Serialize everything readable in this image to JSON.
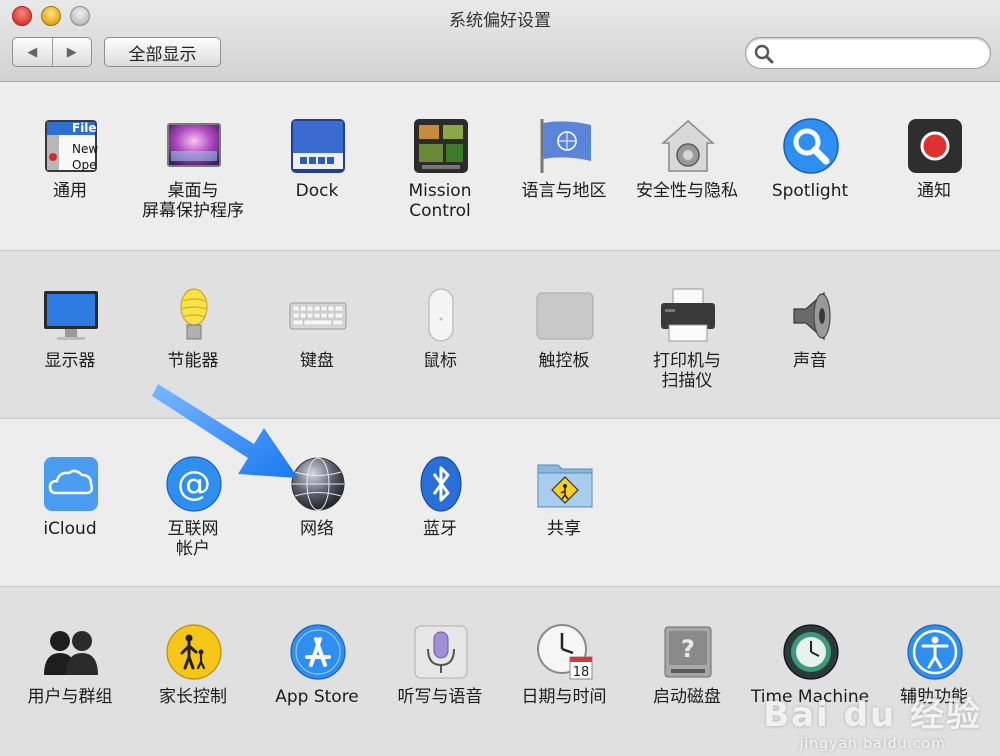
{
  "window": {
    "title": "系统偏好设置"
  },
  "toolbar": {
    "back_glyph": "◀",
    "forward_glyph": "▶",
    "show_all_label": "全部显示",
    "search_value": ""
  },
  "rows": [
    {
      "items": [
        {
          "label": "通用",
          "icon": "general-icon"
        },
        {
          "label": "桌面与\n屏幕保护程序",
          "icon": "desktop-screensaver-icon"
        },
        {
          "label": "Dock",
          "icon": "dock-icon"
        },
        {
          "label": "Mission\nControl",
          "icon": "mission-control-icon"
        },
        {
          "label": "语言与地区",
          "icon": "language-region-icon"
        },
        {
          "label": "安全性与隐私",
          "icon": "security-privacy-icon"
        },
        {
          "label": "Spotlight",
          "icon": "spotlight-icon"
        },
        {
          "label": "通知",
          "icon": "notifications-icon"
        }
      ]
    },
    {
      "items": [
        {
          "label": "显示器",
          "icon": "displays-icon"
        },
        {
          "label": "节能器",
          "icon": "energy-saver-icon"
        },
        {
          "label": "键盘",
          "icon": "keyboard-icon"
        },
        {
          "label": "鼠标",
          "icon": "mouse-icon"
        },
        {
          "label": "触控板",
          "icon": "trackpad-icon"
        },
        {
          "label": "打印机与\n扫描仪",
          "icon": "printer-scanner-icon"
        },
        {
          "label": "声音",
          "icon": "sound-icon"
        }
      ]
    },
    {
      "items": [
        {
          "label": "iCloud",
          "icon": "icloud-icon"
        },
        {
          "label": "互联网\n帐户",
          "icon": "internet-accounts-icon"
        },
        {
          "label": "网络",
          "icon": "network-icon"
        },
        {
          "label": "蓝牙",
          "icon": "bluetooth-icon"
        },
        {
          "label": "共享",
          "icon": "sharing-icon"
        }
      ]
    },
    {
      "items": [
        {
          "label": "用户与群组",
          "icon": "users-groups-icon"
        },
        {
          "label": "家长控制",
          "icon": "parental-controls-icon"
        },
        {
          "label": "App Store",
          "icon": "app-store-icon"
        },
        {
          "label": "听写与语音",
          "icon": "dictation-speech-icon"
        },
        {
          "label": "日期与时间",
          "icon": "date-time-icon"
        },
        {
          "label": "启动磁盘",
          "icon": "startup-disk-icon"
        },
        {
          "label": "Time Machine",
          "icon": "time-machine-icon"
        },
        {
          "label": "辅助功能",
          "icon": "accessibility-icon"
        }
      ]
    }
  ],
  "icon_text": {
    "general_file": "File",
    "general_new": "New",
    "general_open": "Ope",
    "date_day": "18"
  },
  "watermark": {
    "brand": "Bai du 经验",
    "url": "jingyan.baidu.com"
  },
  "colors": {
    "accent_blue": "#2f8ff0",
    "arrow": "#2f8ff0"
  }
}
